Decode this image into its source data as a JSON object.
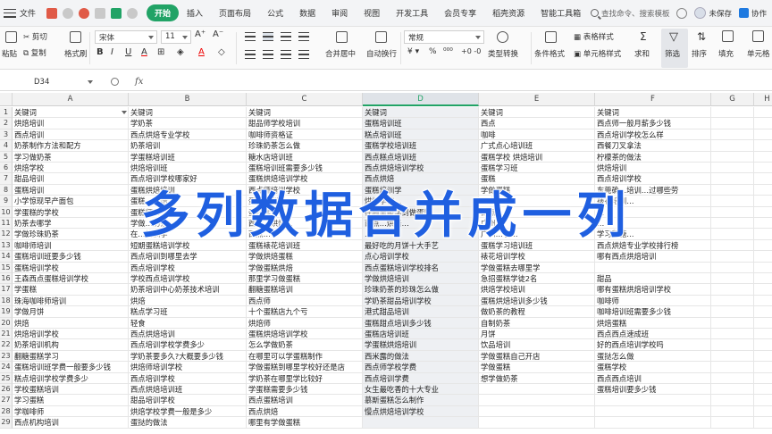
{
  "menubar": {
    "file_label": "文件",
    "tabs": [
      "开始",
      "插入",
      "页面布局",
      "公式",
      "数据",
      "审阅",
      "视图",
      "开发工具",
      "会员专享",
      "稻壳资源",
      "智能工具箱"
    ],
    "active_tab": "开始",
    "search_placeholder": "查找命令、搜索模板",
    "sync_label": "未保存",
    "collab_label": "协作"
  },
  "ribbon": {
    "paste": "粘贴",
    "cut": "剪切",
    "copy": "复制",
    "format_painter": "格式刷",
    "font_name": "宋体",
    "font_size": "11",
    "bold": "B",
    "italic": "I",
    "underline": "U",
    "merge_center": "合并居中",
    "wrap_text": "自动换行",
    "number_format": "常规",
    "type_convert": "类型转换",
    "cond_format": "条件格式",
    "table_style": "表格样式",
    "cell_style": "单元格样式",
    "sum": "求和",
    "filter": "筛选",
    "sort": "排序",
    "fill": "填充",
    "cell": "单元格"
  },
  "formula_bar": {
    "name_box": "D34",
    "fx": "fx"
  },
  "sheet": {
    "columns": [
      "A",
      "B",
      "C",
      "D",
      "E",
      "F",
      "G",
      "H"
    ],
    "active_column": "D",
    "rows": [
      [
        "1",
        "关键词",
        "关键词",
        "关键词",
        "关键词",
        "关键词",
        "关键词"
      ],
      [
        "2",
        "烘焙培训",
        "学奶茶",
        "甜品师学校培训",
        "蛋糕培训班",
        "西点",
        "西点师一般月薪多少钱"
      ],
      [
        "3",
        "西点培训",
        "西点烘焙专业学校",
        "咖啡师资格证",
        "糕点培训班",
        "咖啡",
        "西点培训学校怎么样"
      ],
      [
        "4",
        "奶茶制作方法和配方",
        "奶茶培训",
        "珍珠奶茶怎么做",
        "蛋糕学校培训班",
        "广式点心培训班",
        "西餐刀叉拿法"
      ],
      [
        "5",
        "学习做奶茶",
        "学蛋糕培训班",
        "糖水店培训班",
        "西点糕点培训班",
        "蛋糕学校 烘焙培训",
        "柠檬茶的做法"
      ],
      [
        "6",
        "烘焙学校",
        "烘焙培训班",
        "蛋糕培训班需要多少钱",
        "西点烘焙培训学校",
        "蛋糕学习班",
        "烘焙培训"
      ],
      [
        "7",
        "甜品培训",
        "西点培训学校哪家好",
        "蛋糕烘焙培训学校",
        "西点烘焙",
        "蛋糕",
        "西点培训学校"
      ],
      [
        "8",
        "蛋糕培训",
        "蛋糕烘焙培训",
        "西点师培训学校",
        "蛋糕培训学",
        "学做蛋糕",
        "东莞确…培训…过哪些劳"
      ],
      [
        "9",
        "小学惊现早产面包",
        "蛋糕…烘焙…",
        "蛋糕培训…",
        "烘焙学校…",
        "西点…",
        "裱花培训…"
      ],
      [
        "10",
        "学蛋糕的学校",
        "蛋糕师…",
        "蛋糕学…",
        "在哪里能学到做蛋糕…",
        "西点…",
        "…"
      ],
      [
        "11",
        "奶茶去哪学",
        "学做…奶茶…",
        "西点…烘焙…",
        "西点…烘焙…",
        "广州…",
        "…"
      ],
      [
        "12",
        "学做珍珠奶茶",
        "在…培训学",
        "西点…学",
        "…",
        "广州…学…",
        "学习翻糖…"
      ],
      [
        "13",
        "咖啡师培训",
        "短期蛋糕培训学校",
        "蛋糕裱花培训班",
        "最好吃的月饼十大手艺",
        "蛋糕学习培训班",
        "西点烘焙专业学校排行榜"
      ],
      [
        "14",
        "蛋糕培训班要多少钱",
        "西点培训到哪里去学",
        "学做烘焙蛋糕",
        "点心培训学校",
        "裱花培训学校",
        "哪有西点烘焙培训"
      ],
      [
        "15",
        "蛋糕培训学校",
        "西点培训学校",
        "学做蛋糕烘焙",
        "西点蛋糕培训学校排名",
        "学做蛋糕去哪里学",
        ""
      ],
      [
        "16",
        "王森西点蛋糕培训学校",
        "学校西点培训学校",
        "那里学习做蛋糕",
        "学做烘焙培训",
        "急招蛋糕学徒2名",
        "甜品"
      ],
      [
        "17",
        "学蛋糕",
        "奶茶培训中心奶茶技术培训",
        "翻糖蛋糕培训",
        "珍珠奶茶的珍珠怎么做",
        "烘焙学校培训",
        "哪有蛋糕烘焙培训学校"
      ],
      [
        "18",
        "珠海咖啡师培训",
        "烘焙",
        "西点师",
        "学奶茶甜品培训学校",
        "蛋糕烘焙培训多少钱",
        "咖啡师"
      ],
      [
        "19",
        "学做月饼",
        "糕点学习班",
        "十个蛋糕店九个亏",
        "港式甜品培训",
        "做奶茶的教程",
        "咖啡培训班需要多少钱"
      ],
      [
        "20",
        "烘焙",
        "轻食",
        "烘焙师",
        "蛋糕甜点培训多少钱",
        "自制奶茶",
        "烘焙蛋糕"
      ],
      [
        "21",
        "烘焙培训学校",
        "西点烘焙培训",
        "蛋糕烘焙培训学校",
        "蛋糕店培训班",
        "月饼",
        "西点西点速成班"
      ],
      [
        "22",
        "奶茶培训机构",
        "西点培训学校学费多少",
        "怎么学做奶茶",
        "学蛋糕烘焙培训",
        "饮品培训",
        "好的西点培训学校吗"
      ],
      [
        "23",
        "翻糖蛋糕学习",
        "学奶茶要多久?大概要多少钱",
        "在哪里可以学蛋糕制作",
        "西米露的做法",
        "学做蛋糕自己开店",
        "蛋挞怎么做"
      ],
      [
        "24",
        "蛋糕培训班学费一般要多少钱",
        "烘焙师培训学校",
        "学做蛋糕到哪里学校好还是店",
        "西点师学校学费",
        "学做蛋糕",
        "蛋糕学校"
      ],
      [
        "25",
        "糕点培训学校学费多少",
        "西点培训学校",
        "学奶茶在哪里学比较好",
        "西点培训学费",
        "想学做奶茶",
        "西点西点培训"
      ],
      [
        "26",
        "学校蛋糕培训",
        "西点烘焙培训班",
        "学蛋糕需要多少钱",
        "女生最吃香的十大专业",
        "",
        "蛋糕培训要多少钱"
      ],
      [
        "27",
        "学习蛋糕",
        "甜品培训学校",
        "西点蛋糕培训",
        "慕斯蛋糕怎么制作",
        "",
        ""
      ],
      [
        "28",
        "学咖啡师",
        "烘焙学校学费一般是多少",
        "西点烘焙",
        "慢点烘焙培训学校",
        "",
        ""
      ],
      [
        "29",
        "西点机构培训",
        "蛋挞的做法",
        "哪里有学做蛋糕",
        "",
        "",
        ""
      ]
    ]
  },
  "overlay_title": "多列数据合并成一列",
  "colors": {
    "accent": "#21a366",
    "overlay_text": "#1f5fe0"
  }
}
